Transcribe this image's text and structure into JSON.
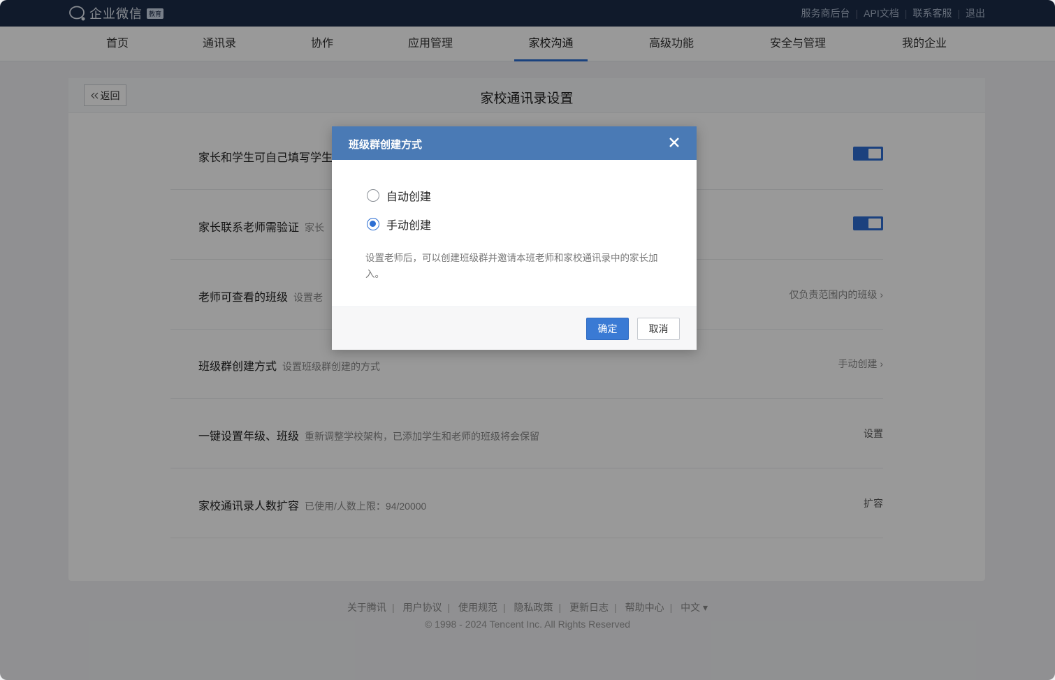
{
  "app": {
    "logo_text": "企业微信",
    "logo_badge": "教育"
  },
  "toplinks": [
    "服务商后台",
    "API文档",
    "联系客服",
    "退出"
  ],
  "nav": {
    "items": [
      "首页",
      "通讯录",
      "协作",
      "应用管理",
      "家校沟通",
      "高级功能",
      "安全与管理",
      "我的企业"
    ],
    "active": "家校沟通"
  },
  "page": {
    "back_label": "返回",
    "title": "家校通讯录设置"
  },
  "settings": [
    {
      "label": "家长和学生可自己填写学生",
      "desc": "",
      "right": "",
      "control": "toggle",
      "on": true
    },
    {
      "label": "家长联系老师需验证",
      "desc": "家长",
      "right": "",
      "control": "toggle",
      "on": true
    },
    {
      "label": "老师可查看的班级",
      "desc": "设置老",
      "right": "仅负责范围内的班级",
      "control": "link"
    },
    {
      "label": "班级群创建方式",
      "desc": "设置班级群创建的方式",
      "right": "手动创建",
      "control": "link"
    },
    {
      "label": "一键设置年级、班级",
      "desc": "重新调整学校架构，已添加学生和老师的班级将会保留",
      "right": "设置",
      "control": "action"
    },
    {
      "label": "家校通讯录人数扩容",
      "desc": "已使用/人数上限：94/20000",
      "right": "扩容",
      "control": "action"
    }
  ],
  "footer": {
    "links": [
      "关于腾讯",
      "用户协议",
      "使用规范",
      "隐私政策",
      "更新日志",
      "帮助中心",
      "中文 ▾"
    ],
    "copyright": "© 1998 - 2024 Tencent Inc. All Rights Reserved"
  },
  "modal": {
    "title": "班级群创建方式",
    "options": [
      {
        "label": "自动创建",
        "checked": false
      },
      {
        "label": "手动创建",
        "checked": true
      }
    ],
    "description": "设置老师后，可以创建班级群并邀请本班老师和家校通讯录中的家长加入。",
    "confirm_label": "确定",
    "cancel_label": "取消"
  },
  "colors": {
    "topbar": "#1c2c48",
    "accent": "#2c6ed3",
    "modal_header": "#4a7ab5"
  }
}
